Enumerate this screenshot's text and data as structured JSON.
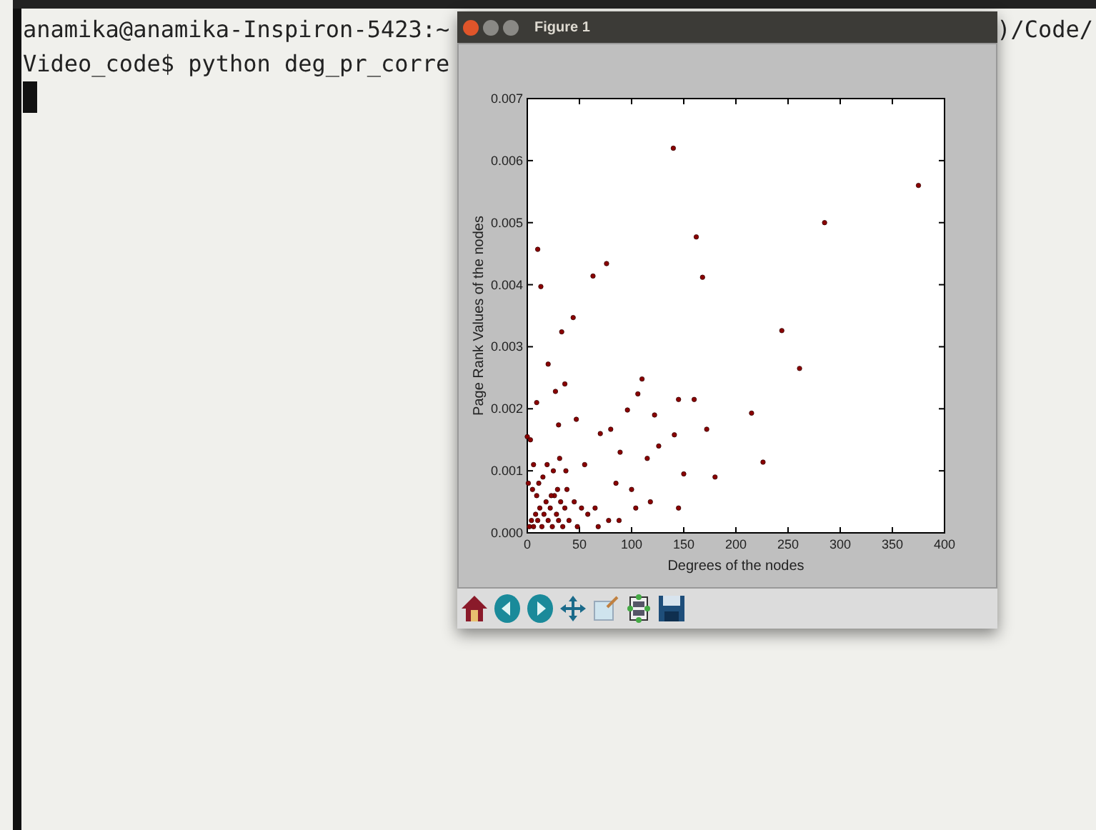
{
  "terminal": {
    "lines": [
      {
        "left": "anamika@anamika-Inspiron-5423:~",
        "right": ")/Code/"
      },
      {
        "left": "Video_code$ python deg_pr_corre"
      }
    ],
    "cursor": true
  },
  "figure_window": {
    "title": "Figure 1",
    "chart_data": {
      "type": "scatter",
      "xlabel": "Degrees of the nodes",
      "ylabel": "Page Rank Values of the nodes",
      "xlim": [
        0,
        400
      ],
      "ylim": [
        0,
        0.007
      ],
      "xticks": [
        0,
        50,
        100,
        150,
        200,
        250,
        300,
        350,
        400
      ],
      "yticks": [
        {
          "value": 0,
          "label": "0.000"
        },
        {
          "value": 0.001,
          "label": "0.001"
        },
        {
          "value": 0.002,
          "label": "0.002"
        },
        {
          "value": 0.003,
          "label": "0.003"
        },
        {
          "value": 0.004,
          "label": "0.004"
        },
        {
          "value": 0.005,
          "label": "0.005"
        },
        {
          "value": 0.006,
          "label": "0.006"
        },
        {
          "value": 0.007,
          "label": "0.007"
        }
      ],
      "x": [
        140,
        375,
        285,
        162,
        168,
        10,
        13,
        76,
        63,
        44,
        33,
        244,
        261,
        20,
        36,
        27,
        110,
        106,
        145,
        160,
        9,
        96,
        122,
        215,
        47,
        30,
        80,
        172,
        0,
        141,
        226,
        180,
        150,
        145,
        126,
        115,
        89,
        70,
        100,
        118,
        85,
        55,
        65,
        2,
        4,
        6,
        8,
        10,
        12,
        14,
        16,
        18,
        20,
        22,
        24,
        26,
        28,
        30,
        32,
        34,
        36,
        38,
        40,
        45,
        48,
        5,
        9,
        11,
        15,
        19,
        23,
        25,
        29,
        31,
        37,
        1,
        3,
        6,
        52,
        58,
        68,
        78,
        88,
        104
      ],
      "series": [
        {
          "color": "#8b0000",
          "values": [
            0.0062,
            0.0056,
            0.005,
            0.00477,
            0.00412,
            0.00457,
            0.00397,
            0.00434,
            0.00414,
            0.00347,
            0.00324,
            0.00326,
            0.00265,
            0.00272,
            0.0024,
            0.00228,
            0.00248,
            0.00224,
            0.00215,
            0.00215,
            0.0021,
            0.00198,
            0.0019,
            0.00193,
            0.00183,
            0.00174,
            0.00167,
            0.00167,
            0.00155,
            0.00158,
            0.00114,
            0.0009,
            0.00095,
            0.0004,
            0.0014,
            0.0012,
            0.0013,
            0.0016,
            0.0007,
            0.0005,
            0.0008,
            0.0011,
            0.0004,
            0.0001,
            0.0002,
            0.0001,
            0.0003,
            0.0002,
            0.0004,
            0.0001,
            0.0003,
            0.0005,
            0.0002,
            0.0004,
            0.0001,
            0.0006,
            0.0003,
            0.0002,
            0.0005,
            0.0001,
            0.0004,
            0.0007,
            0.0002,
            0.0005,
            0.0001,
            0.0007,
            0.0006,
            0.0008,
            0.0009,
            0.0011,
            0.0006,
            0.001,
            0.0007,
            0.0012,
            0.001,
            0.0008,
            0.0015,
            0.0011,
            0.0004,
            0.0003,
            0.0001,
            0.0002,
            0.0002,
            0.0004
          ]
        }
      ]
    },
    "toolbar": [
      {
        "kind": "home"
      },
      {
        "kind": "back"
      },
      {
        "kind": "forward"
      },
      {
        "kind": "pan"
      },
      {
        "kind": "zoom"
      },
      {
        "kind": "subplots"
      },
      {
        "kind": "save"
      }
    ]
  }
}
